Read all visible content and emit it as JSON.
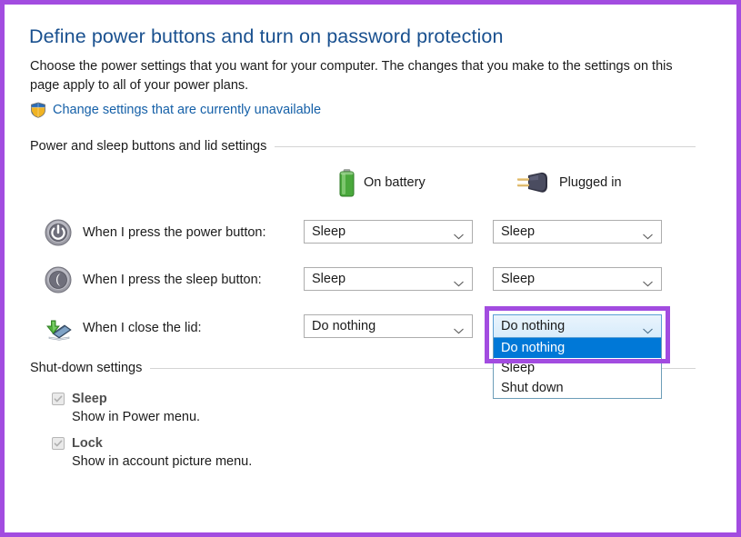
{
  "frame": {
    "accent_color": "#a24ce0"
  },
  "header": {
    "title": "Define power buttons and turn on password protection",
    "description": "Choose the power settings that you want for your computer. The changes that you make to the settings on this page apply to all of your power plans.",
    "uac_link": "Change settings that are currently unavailable",
    "uac_icon": "shield-icon",
    "link_color": "#1560a8",
    "title_color": "#19508f"
  },
  "sections": {
    "power": "Power and sleep buttons and lid settings",
    "shutdown": "Shut-down settings"
  },
  "columns": {
    "battery": {
      "label": "On battery",
      "icon": "battery-icon"
    },
    "plugged": {
      "label": "Plugged in",
      "icon": "power-plug-icon"
    }
  },
  "rows": [
    {
      "label": "When I press the power button:",
      "icon": "power-button-icon",
      "battery_value": "Sleep",
      "plugged_value": "Sleep"
    },
    {
      "label": "When I press the sleep button:",
      "icon": "sleep-button-icon",
      "battery_value": "Sleep",
      "plugged_value": "Sleep"
    },
    {
      "label": "When I close the lid:",
      "icon": "laptop-lid-icon",
      "battery_value": "Do nothing",
      "plugged_value": "Do nothing"
    }
  ],
  "open_dropdown": {
    "selected": "Do nothing",
    "options": [
      "Do nothing",
      "Sleep",
      "Shut down"
    ],
    "highlight_color": "#0078d7"
  },
  "shutdown_settings": [
    {
      "title": "Sleep",
      "description": "Show in Power menu.",
      "checked": true,
      "enabled": false
    },
    {
      "title": "Lock",
      "description": "Show in account picture menu.",
      "checked": true,
      "enabled": false
    }
  ]
}
